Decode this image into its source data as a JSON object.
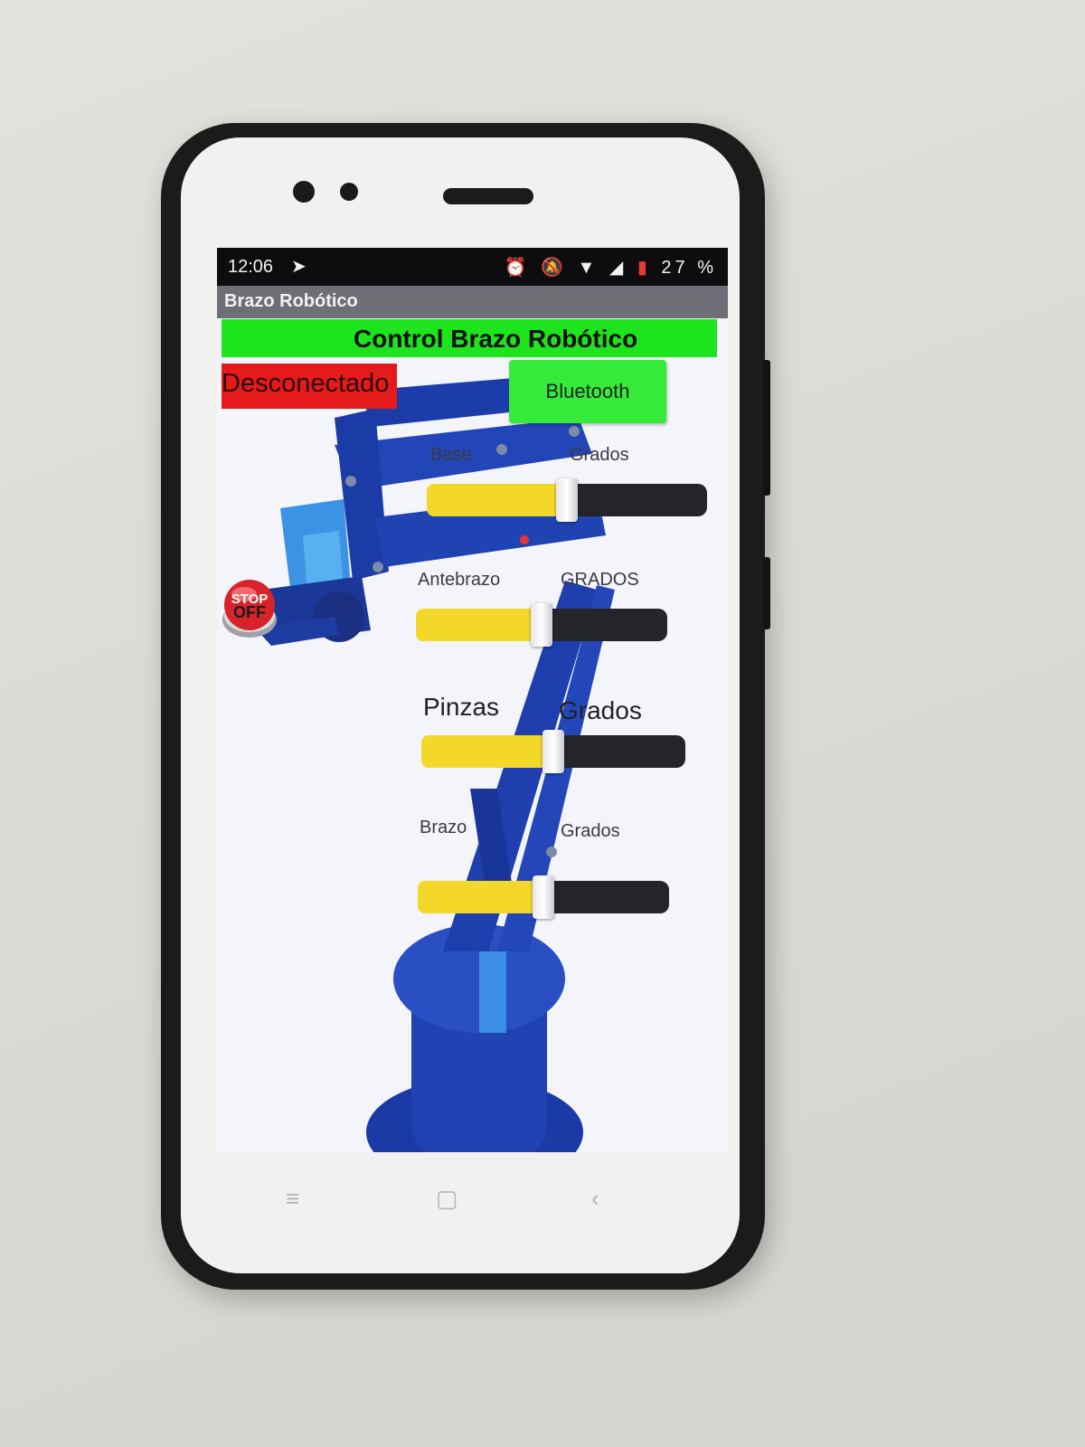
{
  "statusbar": {
    "time": "12:06",
    "battery_percent": "27 %",
    "icons": [
      "telegram-icon",
      "alarm-icon",
      "mute-icon",
      "wifi-icon",
      "signal-icon",
      "battery-icon"
    ]
  },
  "appbar": {
    "title": "Brazo Robótico"
  },
  "main": {
    "title": "Control Brazo Robótico",
    "connection_status": "Desconectado",
    "bluetooth_button": "Bluetooth",
    "stop_button": {
      "label_top": "STOP",
      "label_bottom": "OFF"
    }
  },
  "sliders": [
    {
      "label": "Base",
      "value_label": "Grados",
      "level": 0.5
    },
    {
      "label": "Antebrazo",
      "value_label": "GRADOS",
      "level": 0.5
    },
    {
      "label": "Pinzas",
      "value_label": "Grados",
      "level": 0.5
    },
    {
      "label": "Brazo",
      "value_label": "Grados",
      "level": 0.5
    }
  ],
  "colors": {
    "title_bg": "#1ee41e",
    "status_bg": "#e51b1b",
    "button_bg": "#36ea39",
    "slider_fill": "#f3d829",
    "slider_track": "#23252b",
    "robot_blue": "#1f3fae"
  },
  "navbar": {
    "icons": [
      "menu-icon",
      "home-icon",
      "back-icon"
    ]
  }
}
